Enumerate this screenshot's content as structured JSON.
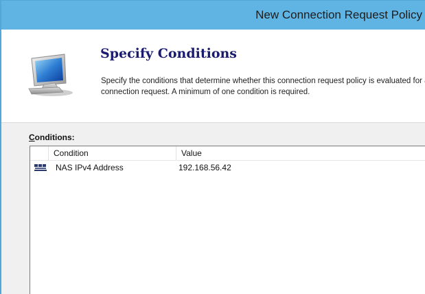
{
  "window": {
    "title": "New Connection Request Policy"
  },
  "header": {
    "title": "Specify Conditions",
    "description": "Specify the conditions that determine whether this connection request policy is evaluated for a connection request. A minimum of one condition is required.",
    "icon": "computer-monitor-icon"
  },
  "conditions": {
    "label_accel": "C",
    "label_rest": "onditions:",
    "columns": [
      "Condition",
      "Value"
    ],
    "rows": [
      {
        "icon": "network-address-icon",
        "condition": "NAS IPv4 Address",
        "value": "192.168.56.42"
      }
    ]
  },
  "colors": {
    "titlebar": "#5fb4e4",
    "title_text": "#1d1d1d",
    "header_title": "#1a1a6e"
  }
}
